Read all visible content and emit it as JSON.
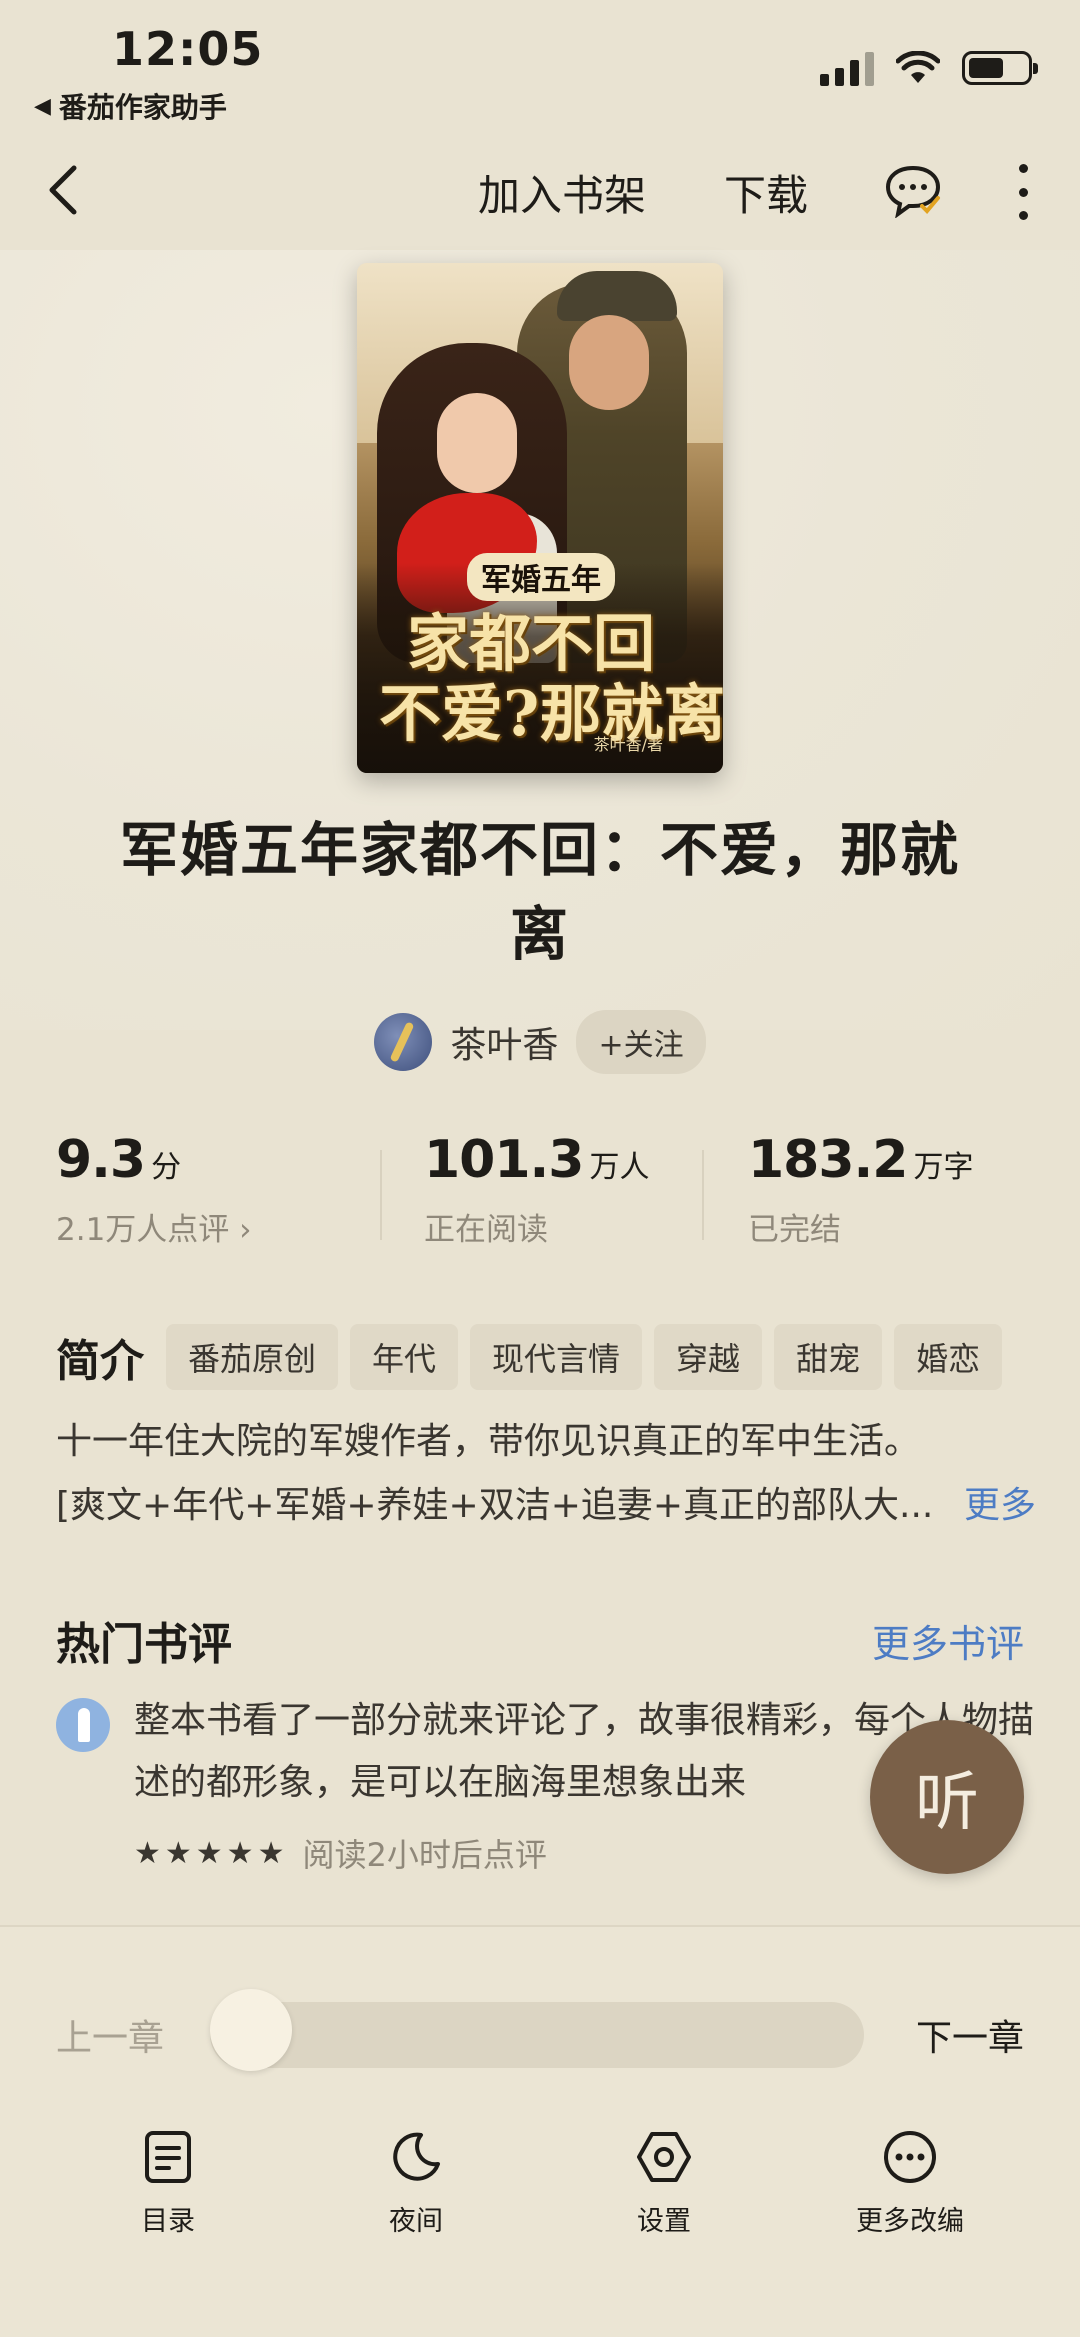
{
  "status_bar": {
    "time": "12:05",
    "back_app": "番茄作家助手"
  },
  "nav": {
    "add_to_shelf": "加入书架",
    "download": "下载"
  },
  "book": {
    "cover": {
      "series_badge": "军婚五年",
      "line1": "家都不回",
      "line2": "不爱?那就离",
      "byline": "茶叶香/著"
    },
    "title": "军婚五年家都不回：不爱，那就离",
    "author": "茶叶香",
    "follow_label": "+关注"
  },
  "stats": [
    {
      "value": "9.3",
      "unit": "分",
      "sub": "2.1万人点评 ›"
    },
    {
      "value": "101.3",
      "unit": "万人",
      "sub": "正在阅读"
    },
    {
      "value": "183.2",
      "unit": "万字",
      "sub": "已完结"
    }
  ],
  "intro": {
    "label": "简介",
    "tags": [
      "番茄原创",
      "年代",
      "现代言情",
      "穿越",
      "甜宠",
      "婚恋"
    ],
    "line1": "十一年住大院的军嫂作者，带你见识真正的军中生活。",
    "line2": "[爽文+年代+军婚+养娃+双洁+追妻+真正的部队大...",
    "more": "更多"
  },
  "reviews": {
    "title": "热门书评",
    "more": "更多书评",
    "items": [
      {
        "text": "整本书看了一部分就来评论了，故事很精彩，每个人物描述的都形象，是可以在脑海里想象出来",
        "stars": "★★★★★",
        "meta": "阅读2小时后点评"
      }
    ]
  },
  "listen_label": "听",
  "chapter_nav": {
    "prev": "上一章",
    "next": "下一章",
    "progress": 0.0
  },
  "toolbar": {
    "catalog": "目录",
    "night": "夜间",
    "settings": "设置",
    "more_adapt": "更多改编"
  },
  "colors": {
    "background": "#e9e3d2",
    "accent_link": "#4d7cc4",
    "listen_button": "#7a6048",
    "comment_badge": "#e2a321"
  },
  "icons": {
    "back": "chevron-left-icon",
    "comment": "comment-bubble-icon",
    "more": "vertical-dots-icon",
    "catalog": "document-list-icon",
    "night": "moon-icon",
    "settings": "hexagon-gear-icon",
    "more_adapt": "ellipsis-circle-icon"
  }
}
